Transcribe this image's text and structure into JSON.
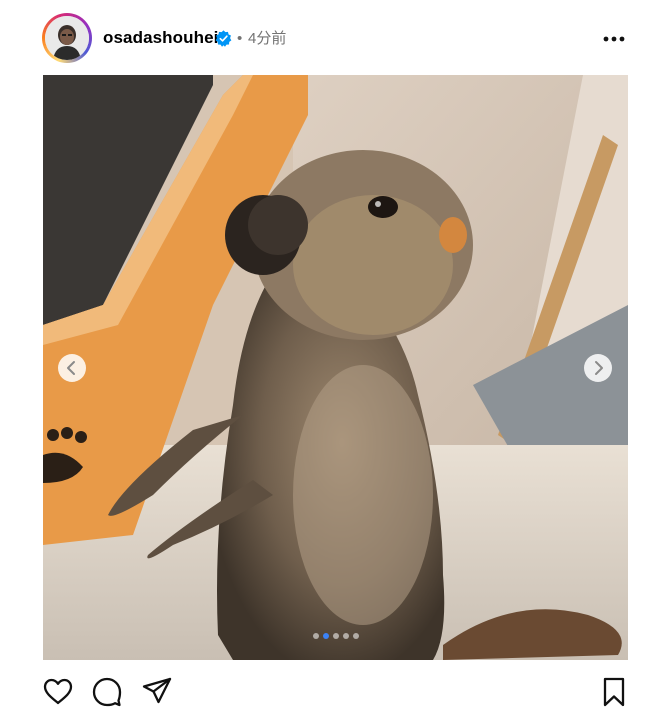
{
  "post": {
    "username": "osadashouhei",
    "verified": true,
    "separator": "•",
    "time_ago": "4分前",
    "carousel": {
      "total": 5,
      "active_index": 1
    }
  },
  "colors": {
    "verified_badge": "#0095f6",
    "carousel_active_dot": "#3b82f6",
    "muted_text": "#737373"
  },
  "icons": {
    "like": "heart-icon",
    "comment": "comment-icon",
    "share": "paper-plane-icon",
    "save": "bookmark-icon",
    "more": "more-options-icon",
    "prev": "chevron-left-icon",
    "next": "chevron-right-icon"
  }
}
